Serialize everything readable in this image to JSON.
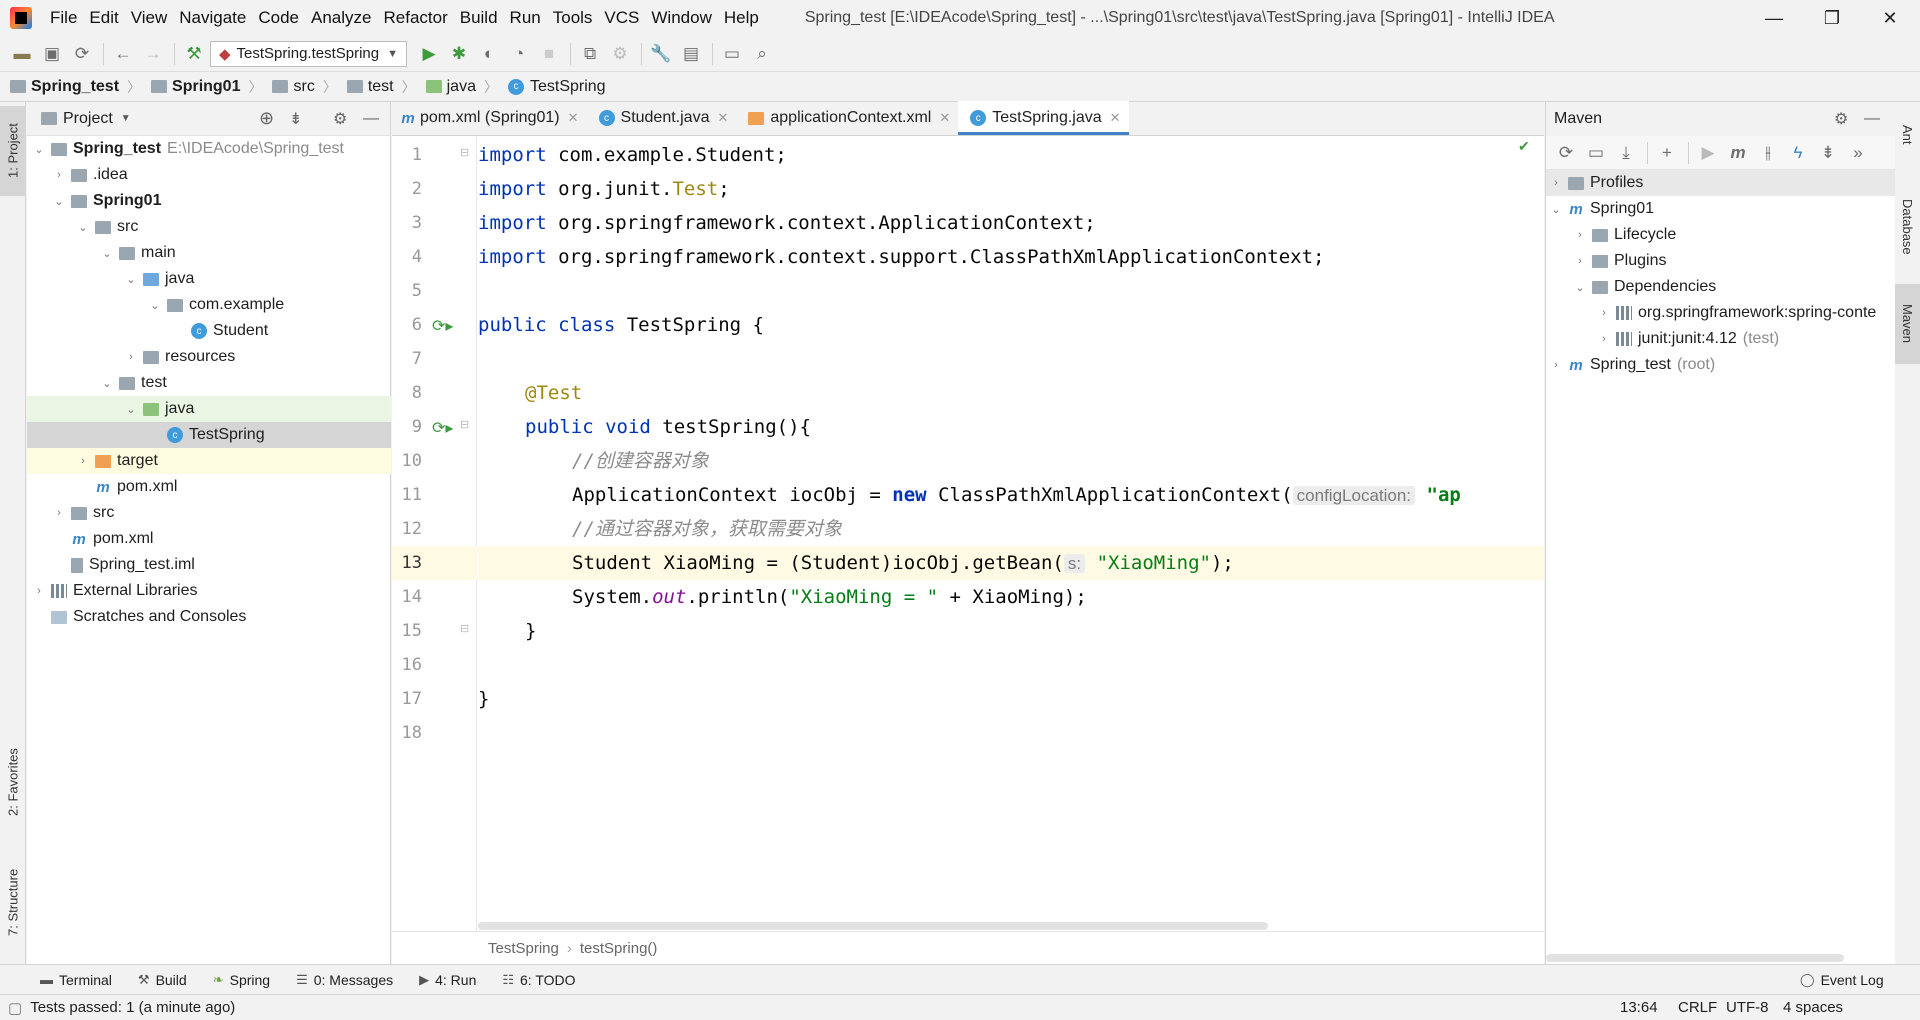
{
  "menu": [
    "File",
    "Edit",
    "View",
    "Navigate",
    "Code",
    "Analyze",
    "Refactor",
    "Build",
    "Run",
    "Tools",
    "VCS",
    "Window",
    "Help"
  ],
  "window_title": "Spring_test [E:\\IDEAcode\\Spring_test] - ...\\Spring01\\src\\test\\java\\TestSpring.java [Spring01] - IntelliJ IDEA",
  "toolbar": {
    "run_config": "TestSpring.testSpring"
  },
  "breadcrumb": [
    "Spring_test",
    "Spring01",
    "src",
    "test",
    "java",
    "TestSpring"
  ],
  "left_stripe": {
    "project": "1: Project",
    "favorites": "2: Favorites",
    "structure": "7: Structure"
  },
  "project": {
    "title": "Project",
    "tree": [
      {
        "label": "Spring_test",
        "extra": "E:\\IDEAcode\\Spring_test"
      },
      {
        "label": ".idea"
      },
      {
        "label": "Spring01"
      },
      {
        "label": "src"
      },
      {
        "label": "main"
      },
      {
        "label": "java"
      },
      {
        "label": "com.example"
      },
      {
        "label": "Student"
      },
      {
        "label": "resources"
      },
      {
        "label": "test"
      },
      {
        "label": "java"
      },
      {
        "label": "TestSpring"
      },
      {
        "label": "target"
      },
      {
        "label": "pom.xml"
      },
      {
        "label": "src"
      },
      {
        "label": "pom.xml"
      },
      {
        "label": "Spring_test.iml"
      },
      {
        "label": "External Libraries"
      },
      {
        "label": "Scratches and Consoles"
      }
    ]
  },
  "editor": {
    "tabs": [
      "pom.xml (Spring01)",
      "Student.java",
      "applicationContext.xml",
      "TestSpring.java"
    ],
    "line_numbers": [
      "1",
      "2",
      "3",
      "4",
      "5",
      "6",
      "7",
      "8",
      "9",
      "10",
      "11",
      "12",
      "13",
      "14",
      "15",
      "16",
      "17",
      "18"
    ],
    "code": {
      "l1": [
        "import",
        " com.example.Student;"
      ],
      "l2": [
        "import",
        " org.junit.",
        "Test",
        ";"
      ],
      "l3": [
        "import",
        " org.springframework.context.ApplicationContext;"
      ],
      "l4": [
        "import",
        " org.springframework.context.support.ClassPathXmlApplicationContext;"
      ],
      "l6": [
        "public class",
        " TestSpring {"
      ],
      "l8": "@Test",
      "l9": [
        "public void",
        " testSpring(){"
      ],
      "l10": "//创建容器对象",
      "l11": [
        "ApplicationContext iocObj = ",
        "new",
        " ClassPathXmlApplicationContext(",
        "configLocation:",
        "\"ap"
      ],
      "l12": "//通过容器对象，获取需要对象",
      "l13": [
        "Student XiaoMing = (Student)iocObj.getBean(",
        "s:",
        "\"XiaoMing\"",
        ");"
      ],
      "l14": [
        "System.",
        "out",
        ".println(",
        "\"XiaoMing = \"",
        " + XiaoMing);"
      ],
      "l15": "}",
      "l17": "}"
    },
    "footer": [
      "TestSpring",
      "testSpring()"
    ]
  },
  "maven": {
    "title": "Maven",
    "tree": [
      {
        "label": "Profiles"
      },
      {
        "label": "Spring01"
      },
      {
        "label": "Lifecycle"
      },
      {
        "label": "Plugins"
      },
      {
        "label": "Dependencies"
      },
      {
        "label": "org.springframework:spring-conte"
      },
      {
        "label": "junit:junit:4.12",
        "extra": "(test)"
      },
      {
        "label": "Spring_test",
        "extra": "(root)"
      }
    ]
  },
  "right_stripe": {
    "ant": "Ant",
    "database": "Database",
    "maven": "Maven"
  },
  "bottom_tabs": [
    "Terminal",
    "Build",
    "Spring",
    "0: Messages",
    "4: Run",
    "6: TODO"
  ],
  "event_log": "Event Log",
  "status": {
    "message": "Tests passed: 1 (a minute ago)",
    "position": "13:64",
    "line_sep": "CRLF",
    "encoding": "UTF-8",
    "indent": "4 spaces"
  },
  "colors": {
    "accent": "#4083c9",
    "keyword": "#0033b3",
    "string": "#067d17",
    "comment": "#8c8c8c",
    "annotation": "#9e880d",
    "current_line": "#fffae3",
    "selected_row": "#d5d5d5"
  }
}
